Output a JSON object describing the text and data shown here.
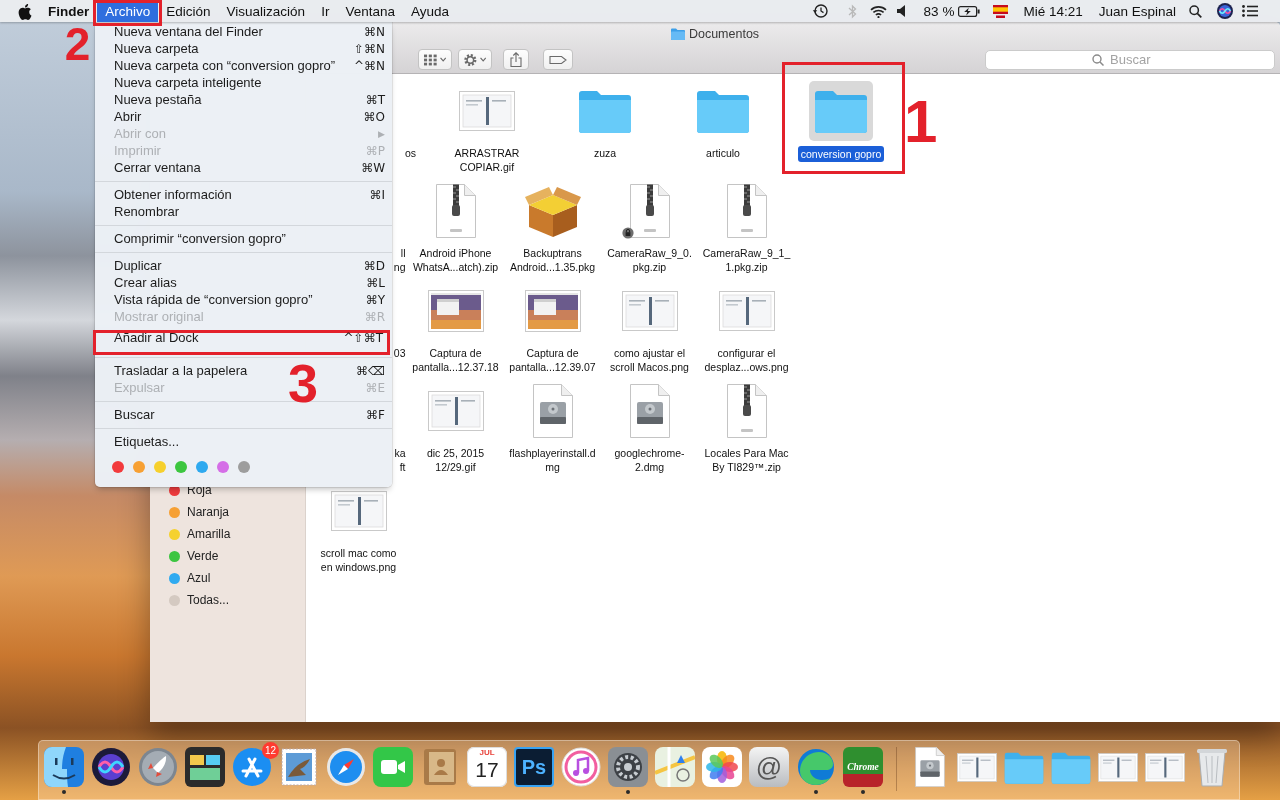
{
  "menu_bar": {
    "menus": [
      {
        "kind": "apple",
        "selected": false
      },
      {
        "kind": "app",
        "label": "Finder",
        "selected": false
      },
      {
        "kind": "menu",
        "label": "Archivo",
        "selected": true,
        "callout": "2"
      },
      {
        "kind": "menu",
        "label": "Edición",
        "selected": false
      },
      {
        "kind": "menu",
        "label": "Visualización",
        "selected": false
      },
      {
        "kind": "menu",
        "label": "Ir",
        "selected": false
      },
      {
        "kind": "menu",
        "label": "Ventana",
        "selected": false
      },
      {
        "kind": "menu",
        "label": "Ayuda",
        "selected": false
      }
    ],
    "status": [
      {
        "kind": "time-machine"
      },
      {
        "kind": "bluetooth"
      },
      {
        "kind": "wifi"
      },
      {
        "kind": "volume"
      },
      {
        "kind": "battery-level",
        "label": "83 %"
      },
      {
        "kind": "battery"
      },
      {
        "kind": "input-flag"
      },
      {
        "kind": "clock",
        "label": "Mié 14:21"
      },
      {
        "kind": "user",
        "label": "Juan Espinal"
      },
      {
        "kind": "spotlight"
      },
      {
        "kind": "siri"
      },
      {
        "kind": "notifications"
      }
    ]
  },
  "open_menu": {
    "items": [
      {
        "kind": "item",
        "label": "Nueva ventana del Finder",
        "shortcut": "⌘N",
        "disabled": false
      },
      {
        "kind": "item",
        "label": "Nueva carpeta",
        "shortcut": "⇧⌘N",
        "disabled": false
      },
      {
        "kind": "item",
        "label": "Nueva carpeta con “conversion gopro”",
        "shortcut": "^⌘N",
        "disabled": false
      },
      {
        "kind": "item",
        "label": "Nueva carpeta inteligente",
        "disabled": false
      },
      {
        "kind": "item",
        "label": "Nueva pestaña",
        "shortcut": "⌘T",
        "disabled": false
      },
      {
        "kind": "item",
        "label": "Abrir",
        "shortcut": "⌘O",
        "disabled": false
      },
      {
        "kind": "item",
        "label": "Abrir con",
        "submenu_arrow": "▶",
        "disabled": true
      },
      {
        "kind": "item",
        "label": "Imprimir",
        "shortcut": "⌘P",
        "disabled": true
      },
      {
        "kind": "item",
        "label": "Cerrar ventana",
        "shortcut": "⌘W",
        "disabled": false
      },
      {
        "kind": "separator"
      },
      {
        "kind": "item",
        "label": "Obtener información",
        "shortcut": "⌘I",
        "disabled": false
      },
      {
        "kind": "item",
        "label": "Renombrar",
        "disabled": false
      },
      {
        "kind": "separator"
      },
      {
        "kind": "item",
        "label": "Comprimir “conversion gopro”",
        "disabled": false
      },
      {
        "kind": "separator"
      },
      {
        "kind": "item",
        "label": "Duplicar",
        "shortcut": "⌘D",
        "disabled": false
      },
      {
        "kind": "item",
        "label": "Crear alias",
        "shortcut": "⌘L",
        "disabled": false
      },
      {
        "kind": "item",
        "label": "Vista rápida de “conversion gopro”",
        "shortcut": "⌘Y",
        "disabled": false
      },
      {
        "kind": "item",
        "label": "Mostrar original",
        "shortcut": "⌘R",
        "disabled": true
      },
      {
        "kind": "item",
        "label": "Añadir al Dock",
        "shortcut": "^⇧⌘T",
        "disabled": false,
        "callout": "3"
      },
      {
        "kind": "separator"
      },
      {
        "kind": "item",
        "label": "Trasladar a la papelera",
        "shortcut": "⌘⌫",
        "disabled": false
      },
      {
        "kind": "item",
        "label": "Expulsar",
        "shortcut": "⌘E",
        "disabled": true
      },
      {
        "kind": "separator"
      },
      {
        "kind": "item",
        "label": "Buscar",
        "shortcut": "⌘F",
        "disabled": false
      },
      {
        "kind": "separator"
      },
      {
        "kind": "item",
        "label": "Etiquetas...",
        "disabled": false
      },
      {
        "kind": "tags",
        "tags": [
          {
            "color": "#f23a3c"
          },
          {
            "color": "#f7a033"
          },
          {
            "color": "#f6d02d"
          },
          {
            "color": "#3cc63f"
          },
          {
            "color": "#2ea9ef"
          },
          {
            "color": "#d56ee7"
          },
          {
            "color": "#9d9d9d"
          }
        ]
      }
    ]
  },
  "window": {
    "title": "Documentos",
    "toolbar": [
      {
        "kind": "view-mode"
      },
      {
        "kind": "action"
      },
      {
        "kind": "share"
      },
      {
        "kind": "tag"
      }
    ],
    "search": {
      "placeholder": "Buscar"
    },
    "sidebar": {
      "items": [
        {
          "label": "Roja",
          "color": "#ee3b3d"
        },
        {
          "label": "Naranja",
          "color": "#f6a034"
        },
        {
          "label": "Amarilla",
          "color": "#f5d12f"
        },
        {
          "label": "Verde",
          "color": "#3dc541"
        },
        {
          "label": "Azul",
          "color": "#30aaf0"
        },
        {
          "label": "Todas...",
          "color": "#d4c9c1"
        }
      ]
    },
    "files": {
      "first_row": [
        {
          "kind": "covered",
          "label": "os",
          "selected": false
        },
        {
          "kind": "image",
          "label": "ARRASTRAR COPIAR.gif",
          "selected": false,
          "badged": false
        },
        {
          "kind": "folder",
          "label": "zuza",
          "selected": false,
          "badged": false
        },
        {
          "kind": "folder",
          "label": "articulo",
          "selected": false,
          "badged": false
        },
        {
          "kind": "folder",
          "label": "conversion gopro",
          "selected": true,
          "badged": false,
          "callout": "1"
        }
      ],
      "rows": [
        [
          {
            "kind": "covered",
            "label": "ll ng",
            "selected": false
          },
          {
            "kind": "zip",
            "label": "Android iPhone WhatsA...atch).zip",
            "selected": false,
            "badged": false
          },
          {
            "kind": "package",
            "label": "Backuptrans Android...1.35.pkg",
            "selected": false,
            "badged": false
          },
          {
            "kind": "zip",
            "label": "CameraRaw_9_0.pkg.zip",
            "selected": false,
            "badged": true
          },
          {
            "kind": "zip",
            "label": "CameraRaw_9_1_1.pkg.zip",
            "selected": false,
            "badged": false
          }
        ],
        [
          {
            "kind": "covered",
            "label": "03",
            "selected": false
          },
          {
            "kind": "screenshot",
            "label": "Captura de pantalla...12.37.18",
            "selected": false,
            "badged": false
          },
          {
            "kind": "screenshot",
            "label": "Captura de pantalla...12.39.07",
            "selected": false,
            "badged": false
          },
          {
            "kind": "image",
            "label": "como ajustar el scroll Macos.png",
            "selected": false,
            "badged": false
          },
          {
            "kind": "image",
            "label": "configurar el desplaz...ows.png",
            "selected": false,
            "badged": false
          }
        ],
        [
          {
            "kind": "covered",
            "label": "ka ft",
            "selected": false
          },
          {
            "kind": "image",
            "label": "dic 25, 2015 12/29.gif",
            "selected": false,
            "badged": false
          },
          {
            "kind": "disk-image",
            "label": "flashplayerinstall.dmg",
            "selected": false,
            "badged": false
          },
          {
            "kind": "disk-image",
            "label": "googlechrome-2.dmg",
            "selected": false,
            "badged": false
          },
          {
            "kind": "zip",
            "label": "Locales Para Mac By TI829™.zip",
            "selected": false,
            "badged": false
          }
        ],
        [
          {
            "kind": "image",
            "label": "scroll mac como en windows.png",
            "selected": false,
            "badged": false
          }
        ]
      ]
    }
  },
  "dock": {
    "apps": [
      {
        "kind": "finder",
        "running": true
      },
      {
        "kind": "siri",
        "running": false
      },
      {
        "kind": "launchpad",
        "running": false
      },
      {
        "kind": "screens",
        "running": false
      },
      {
        "kind": "app-store",
        "badge": "12",
        "running": false
      },
      {
        "kind": "stamp",
        "running": false
      },
      {
        "kind": "safari",
        "running": false
      },
      {
        "kind": "facetime",
        "running": false
      },
      {
        "kind": "contacts",
        "running": false
      },
      {
        "kind": "calendar",
        "month": "JUL",
        "label": "17",
        "running": false
      },
      {
        "kind": "photoshop",
        "label": "Ps",
        "running": false
      },
      {
        "kind": "itunes",
        "running": false
      },
      {
        "kind": "preferences",
        "running": true
      },
      {
        "kind": "maps",
        "running": false
      },
      {
        "kind": "photos",
        "running": false
      },
      {
        "kind": "at-mail",
        "label": "@",
        "running": false
      },
      {
        "kind": "edge",
        "running": true
      },
      {
        "kind": "chrome-tile",
        "label": "Chrome",
        "running": true
      }
    ],
    "documents": [
      {
        "kind": "disk-image"
      },
      {
        "kind": "image"
      },
      {
        "kind": "folder"
      },
      {
        "kind": "folder"
      },
      {
        "kind": "image"
      },
      {
        "kind": "image"
      },
      {
        "kind": "trash"
      }
    ]
  }
}
